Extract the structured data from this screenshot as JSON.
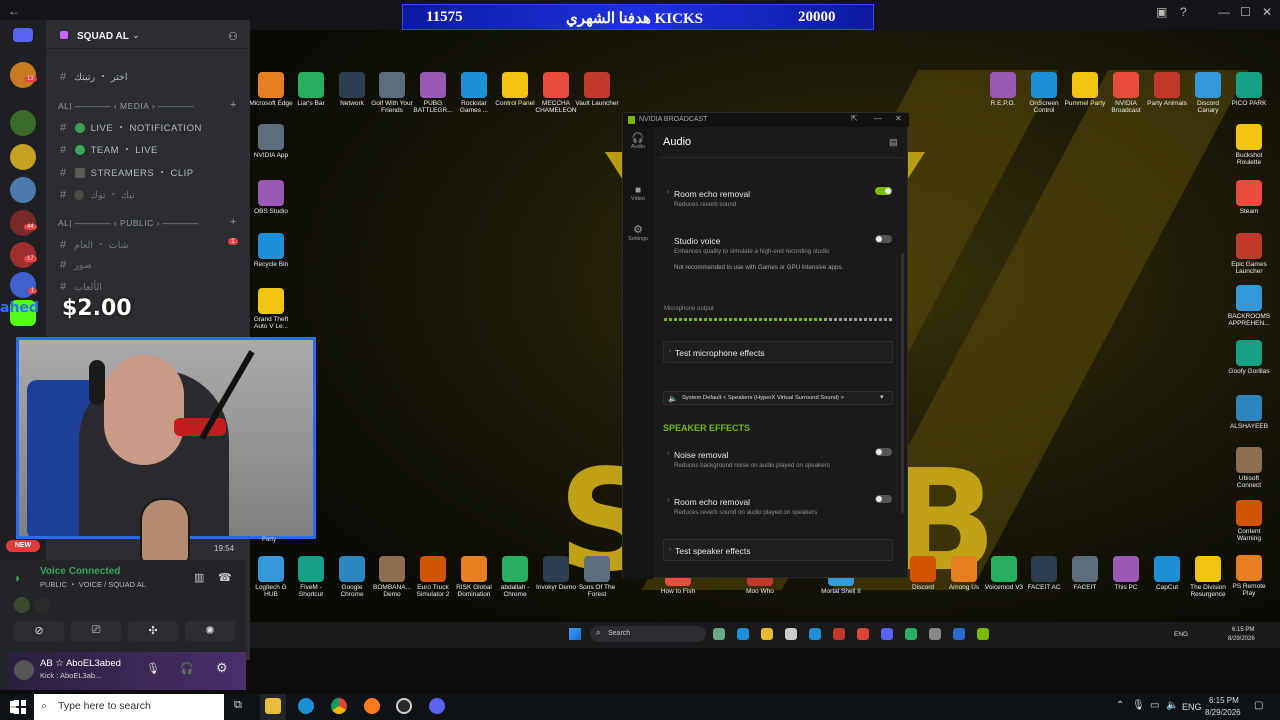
{
  "top_bar": {
    "kicks_count": "11575",
    "kicks_goal_text": "هدفنا الشهري KICKS",
    "kicks_goal": "20000"
  },
  "discord": {
    "server_name": "SQUAD AL",
    "server_badges": [
      "13",
      "44",
      "17",
      "1"
    ],
    "categories": {
      "media": "AL| ———— ‹ MEDIA › ————",
      "public": "AL| ———— ‹ PUBLIC › ————"
    },
    "channels": {
      "top1": "اختر ・ رتبتك",
      "live": "LIVE ・ NOTIFICATION",
      "team": "TEAM ・ LIVE",
      "streamers": "STREAMERS ・ CLIP",
      "tiktok": "تيك ・ توك",
      "chat": "شات ・ العام",
      "pics": "صور",
      "games": "الألعاب",
      "chat_badge": "1"
    },
    "donation": "$2.00",
    "donation_name": "ahed",
    "new_badge": "NEW",
    "time_overlay": "19:54",
    "voice_status": "Voice Connected",
    "voice_channel": "PUBLIC ・ VOICE / SQUAD AL",
    "user_name": "AB ☆ AboEL3abed",
    "user_status": "Kick : AboEL3ab..."
  },
  "nvidia": {
    "window_title": "NVIDIA BROADCAST",
    "section_title": "Audio",
    "sidebar": [
      "Audio",
      "Video",
      "Settings"
    ],
    "mic": {
      "room_echo_title": "Room echo removal",
      "room_echo_desc": "Reduces reverb sound",
      "room_echo_on": true,
      "studio_title": "Studio voice",
      "studio_desc": "Enhances quality to simulate a high-end recording studio",
      "studio_warning": "Not recommended to use with Games or GPU intensive apps.",
      "output_label": "Microphone output",
      "test_label": "Test microphone effects"
    },
    "speaker_device": "System Default < Speakers (HyperX Virtual Surround Sound) >",
    "speaker_heading": "SPEAKER EFFECTS",
    "speaker": {
      "noise_title": "Noise removal",
      "noise_desc": "Reduces background noise on audio played on speakers",
      "echo_title": "Room echo removal",
      "echo_desc": "Reduces reverb sound on audio played on speakers",
      "test_label": "Test speaker effects"
    }
  },
  "desktop_icons_top": [
    "Microsoft Edge",
    "Liar's Bar",
    "Network",
    "Golf With Your Friends",
    "PUBG BATTLEGR...",
    "Rockstar Games ...",
    "Control Panel",
    "MECCHA CHAMELEON",
    "Vault Launcher"
  ],
  "desktop_icons_top_right": [
    "R.E.P.O.",
    "OnScreen Control",
    "Pummel Party",
    "NVIDIA Broadcast",
    "Party Animals",
    "Discord Canary",
    "PICO PARK"
  ],
  "desktop_icons_left": [
    "NVIDIA App",
    "OBS Studio",
    "Recycle Bin",
    "Grand Theft Auto V Le..."
  ],
  "desktop_icons_right": [
    "Buckshot Roulette",
    "Steam",
    "Epic Games Launcher",
    "BACKROOMS APPREHEN...",
    "Goofy Gorillas",
    "ALSHAYEEB",
    "Ubisoft Connect",
    "Content Warning",
    "PS Remote Play"
  ],
  "desktop_icons_bottom": [
    "Logitech G HUB",
    "FiveM - Shortcut",
    "Google Chrome",
    "BOMBANA... Demo",
    "Euro Truck Simulator 2",
    "RISK Global Domination",
    "abdallah - Chrome",
    "Invokyr Demo",
    "Sons Of The Forest"
  ],
  "desktop_icons_bottom_mid": [
    "How to Fish",
    "Moo Who",
    "Mortal Shell II"
  ],
  "desktop_icons_bottom_right": [
    "Discord",
    "Among Us",
    "Voicemod V3",
    "FACEIT AC",
    "FACEIT",
    "This PC",
    "CapCut",
    "The Division Resurgence"
  ],
  "party_label": "Party",
  "stream_taskbar": {
    "search": "Search",
    "lang": "ENG",
    "time": "6:15 PM",
    "date": "8/29/2026"
  },
  "windows_taskbar": {
    "search_placeholder": "Type here to search",
    "lang": "ENG",
    "time": "6:15 PM",
    "date": "8/29/2026"
  },
  "colors": {
    "nvidia_green": "#76b900",
    "discord_bg": "#2b2d31",
    "kicks_blue": "#1f2fe0"
  }
}
